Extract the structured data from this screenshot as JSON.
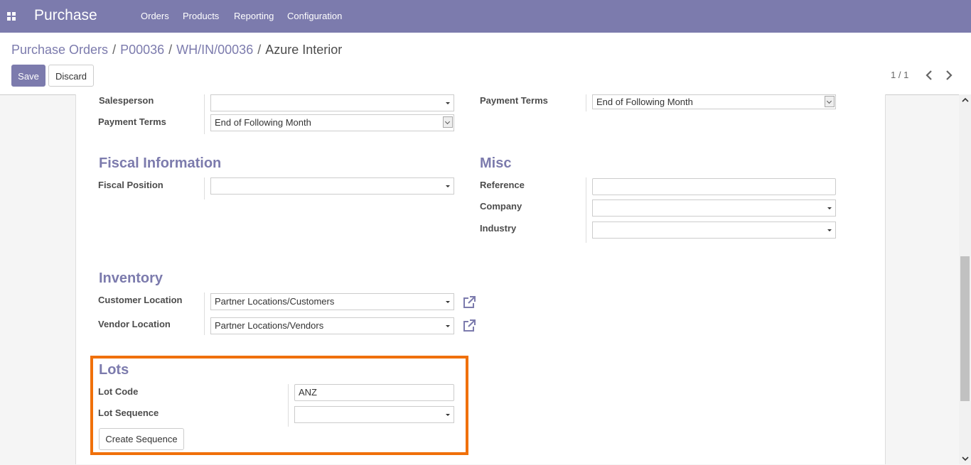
{
  "topbar": {
    "app_name": "Purchase",
    "menu": [
      "Orders",
      "Products",
      "Reporting",
      "Configuration"
    ],
    "bg_color": "#7c7bad"
  },
  "breadcrumb": [
    "Purchase Orders",
    "P00036",
    "WH/IN/00036",
    "Azure Interior"
  ],
  "toolbar": {
    "save_label": "Save",
    "discard_label": "Discard"
  },
  "pager": {
    "value": "1 / 1"
  },
  "form": {
    "left_top": {
      "salesperson_label": "Salesperson",
      "salesperson_value": "",
      "payment_terms_label": "Payment Terms",
      "payment_terms_value": "End of Following Month"
    },
    "right_top": {
      "payment_terms_label": "Payment Terms",
      "payment_terms_value": "End of Following Month"
    },
    "fiscal": {
      "title": "Fiscal Information",
      "fiscal_position_label": "Fiscal Position",
      "fiscal_position_value": ""
    },
    "misc": {
      "title": "Misc",
      "reference_label": "Reference",
      "reference_value": "",
      "company_label": "Company",
      "company_value": "",
      "industry_label": "Industry",
      "industry_value": ""
    },
    "inventory": {
      "title": "Inventory",
      "customer_location_label": "Customer Location",
      "customer_location_value": "Partner Locations/Customers",
      "vendor_location_label": "Vendor Location",
      "vendor_location_value": "Partner Locations/Vendors"
    },
    "lots": {
      "title": "Lots",
      "lot_code_label": "Lot Code",
      "lot_code_value": "ANZ",
      "lot_sequence_label": "Lot Sequence",
      "lot_sequence_value": "",
      "create_sequence_label": "Create Sequence",
      "highlight_color": "#f0700a"
    }
  },
  "icons": [
    "apps-icon",
    "chevron-left-icon",
    "chevron-right-icon",
    "external-link-icon"
  ]
}
